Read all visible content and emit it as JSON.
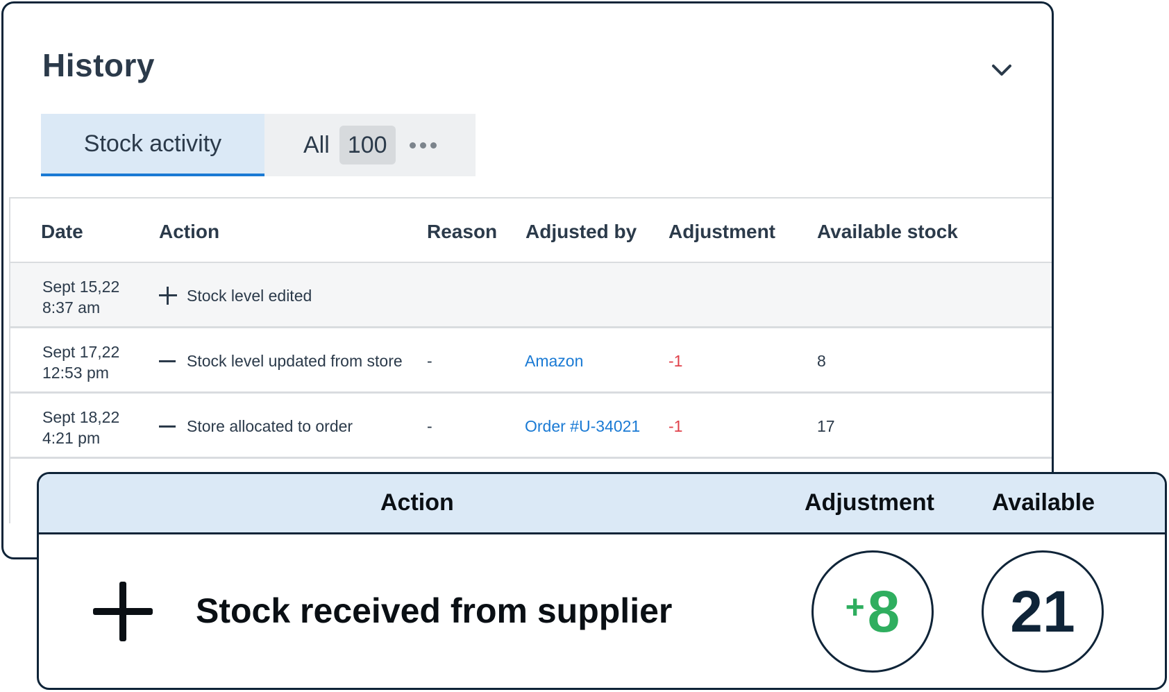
{
  "history": {
    "title": "History",
    "collapse_icon": "chevron-down-icon",
    "tabs": {
      "active": "Stock activity",
      "all_label": "All",
      "all_count": "100",
      "more_icon": "more-horizontal-icon"
    },
    "table": {
      "headers": [
        "Date",
        "Action",
        "Reason",
        "Adjusted by",
        "Adjustment",
        "Available stock"
      ],
      "rows": [
        {
          "date": "Sept 15,22",
          "time": "8:37 am",
          "action_icon": "plus-icon",
          "action": "Stock level edited",
          "reason": "",
          "adjusted_by": "",
          "adjustment": "",
          "available": ""
        },
        {
          "date": "Sept 17,22",
          "time": "12:53 pm",
          "action_icon": "minus-icon",
          "action": "Stock level updated from store",
          "reason": "-",
          "adjusted_by": "Amazon",
          "adjustment": "-1",
          "available": "8"
        },
        {
          "date": "Sept 18,22",
          "time": "4:21 pm",
          "action_icon": "minus-icon",
          "action": "Store allocated to order",
          "reason": "-",
          "adjusted_by": "Order #U-34021",
          "adjustment": "-1",
          "available": "17"
        }
      ]
    }
  },
  "highlight": {
    "headers": {
      "action": "Action",
      "adjustment": "Adjustment",
      "available": "Available"
    },
    "action_icon": "plus-icon",
    "action": "Stock received from supplier",
    "adjustment_sign": "+",
    "adjustment_value": "8",
    "available": "21"
  },
  "colors": {
    "accent": "#1a7ad4",
    "negative": "#e0414a",
    "positive": "#2fae5f",
    "border_dark": "#0f2438",
    "tab_active_bg": "#dbe9f6"
  }
}
